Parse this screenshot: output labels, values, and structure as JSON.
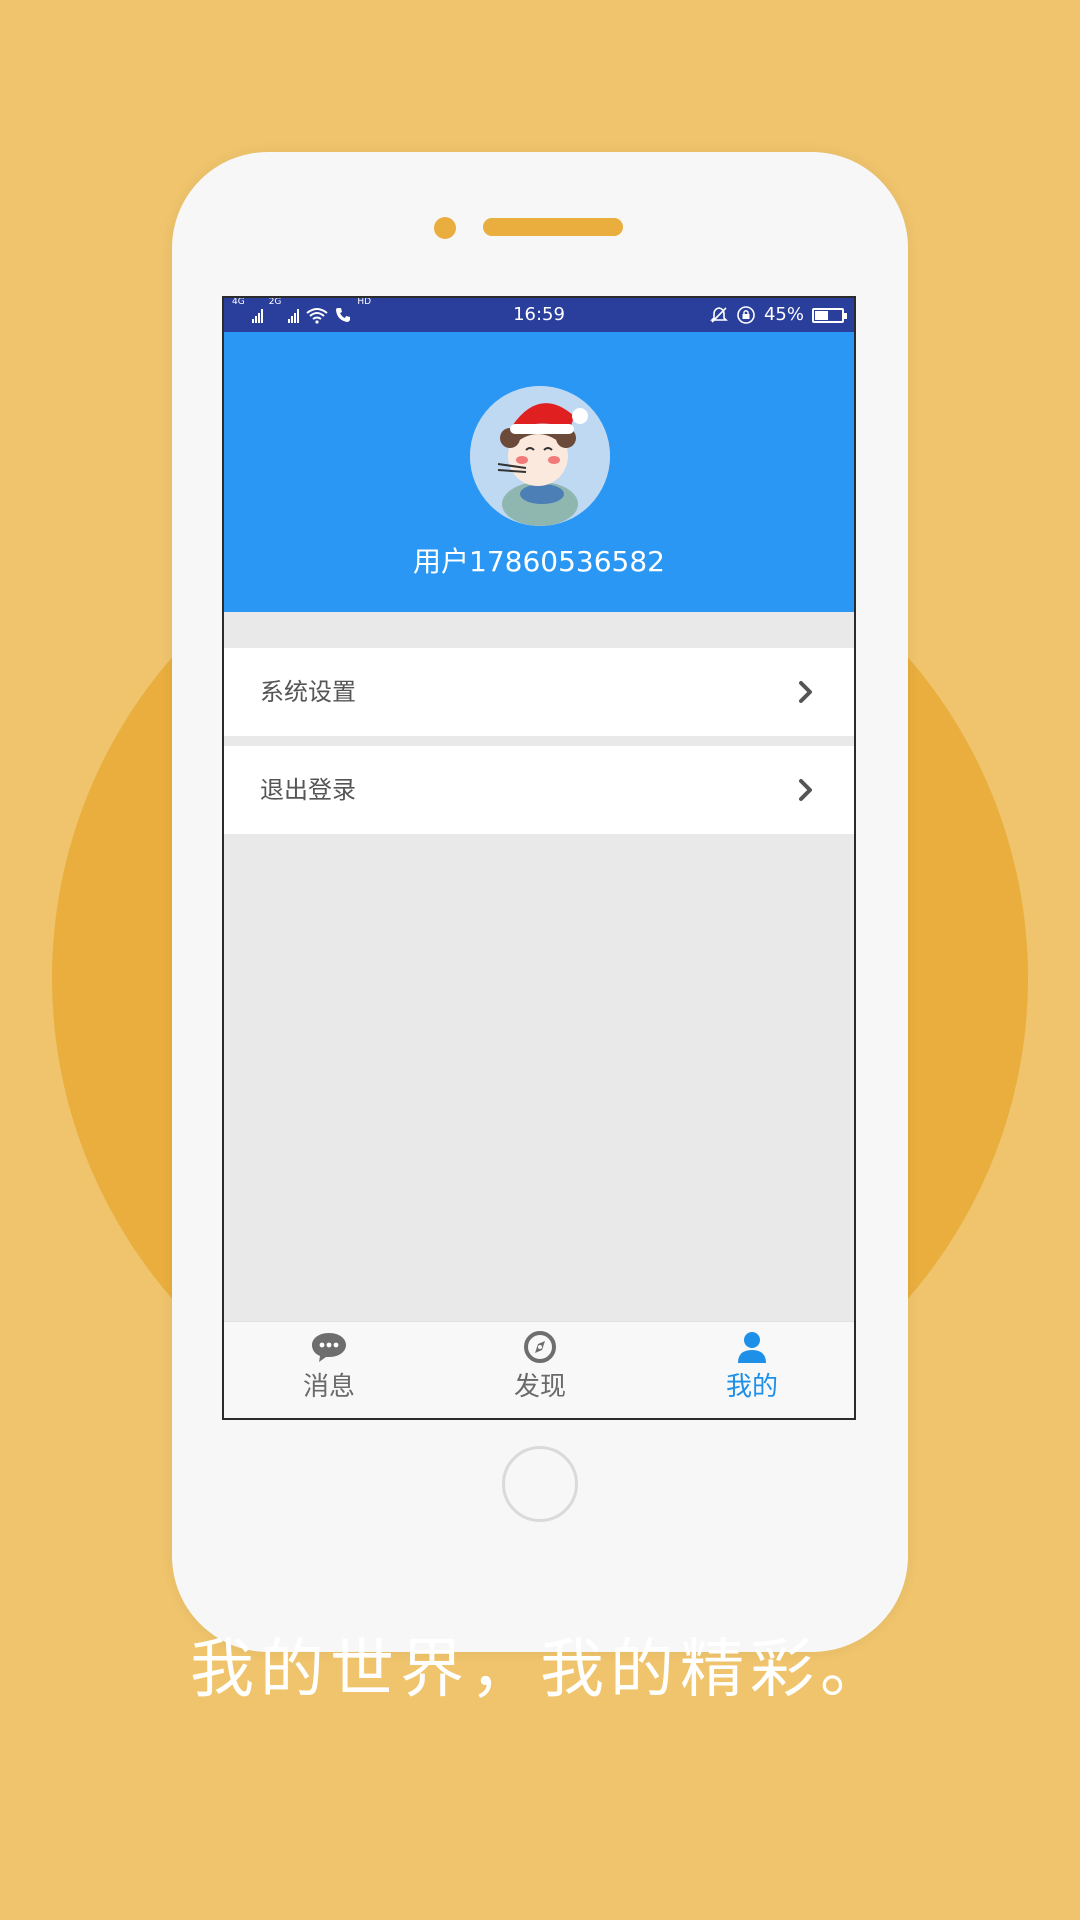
{
  "status_bar": {
    "network_1": "4G",
    "network_2": "2G",
    "call_badge": "HD",
    "time": "16:59",
    "battery_percent": "45%",
    "battery_level": 0.45
  },
  "profile": {
    "username": "用户17860536582"
  },
  "menu": {
    "items": [
      {
        "label": "系统设置",
        "icon": "chevron-right-icon"
      },
      {
        "label": "退出登录",
        "icon": "chevron-right-icon"
      }
    ]
  },
  "tabs": {
    "messages": "消息",
    "discover": "发现",
    "mine": "我的",
    "active_color": "#1E90E8"
  },
  "slogan": "我的世界，我的精彩。",
  "colors": {
    "background": "#EFC46C",
    "accent_circle": "#E9AE3E",
    "header_blue": "#2997F3",
    "status_bar": "#2A3E9C"
  }
}
